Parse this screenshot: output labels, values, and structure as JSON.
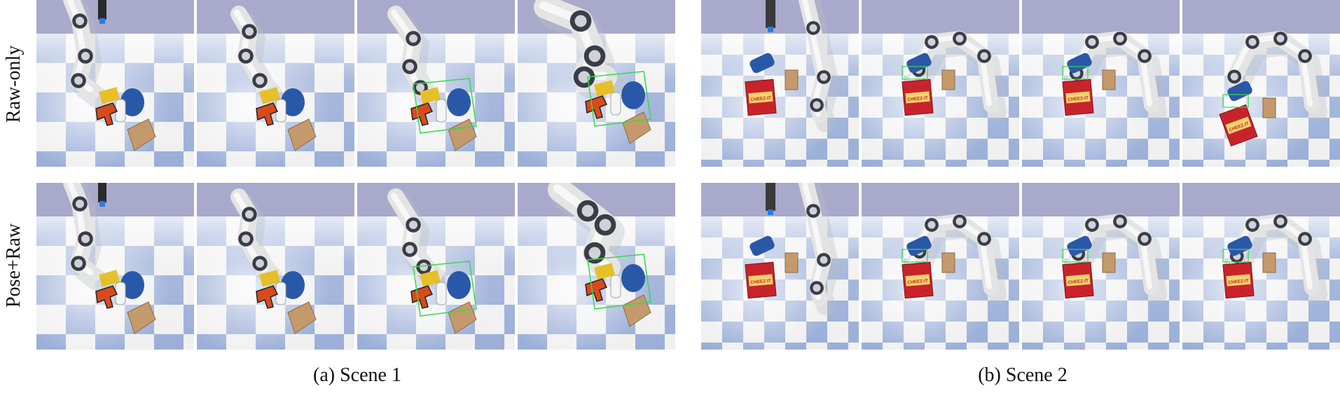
{
  "rows": [
    {
      "label": "Raw-only"
    },
    {
      "label": "Pose+Raw"
    }
  ],
  "captions": {
    "scene1": "(a) Scene 1",
    "scene2": "(b) Scene 2"
  },
  "box_text": "CHEEZ-IT",
  "colors": {
    "sky": "#a9a9cc",
    "floor_light": "#f0f0f0",
    "floor_blue": "#9aaed8",
    "robot": "#e4e4e4",
    "robot_dark": "#3a3d45",
    "detection_box": "#37d94b",
    "cracker_box": "#c8232a",
    "sugar_box": "#c49a6c",
    "mug": "#2a58a8",
    "drill": "#d84a1c"
  }
}
